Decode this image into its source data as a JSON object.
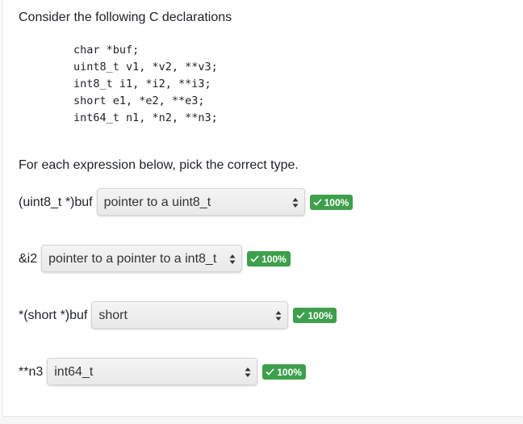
{
  "intro": "Consider the following C declarations",
  "code_lines": [
    "char *buf;",
    "uint8_t v1, *v2, **v3;",
    "int8_t i1, *i2, **i3;",
    "short e1, *e2, **e3;",
    "int64_t n1, *n2, **n3;"
  ],
  "instruction": "For each expression below, pick the correct type.",
  "questions": [
    {
      "label": "(uint8_t *)buf",
      "selected": "pointer to a uint8_t",
      "score": "100%"
    },
    {
      "label": "&i2",
      "selected": "pointer to a pointer to a int8_t",
      "score": "100%"
    },
    {
      "label": "*(short *)buf",
      "selected": "short",
      "score": "100%"
    },
    {
      "label": "**n3",
      "selected": "int64_t",
      "score": "100%"
    }
  ],
  "colors": {
    "badge": "#3e9f4c",
    "text": "#1d2125"
  }
}
